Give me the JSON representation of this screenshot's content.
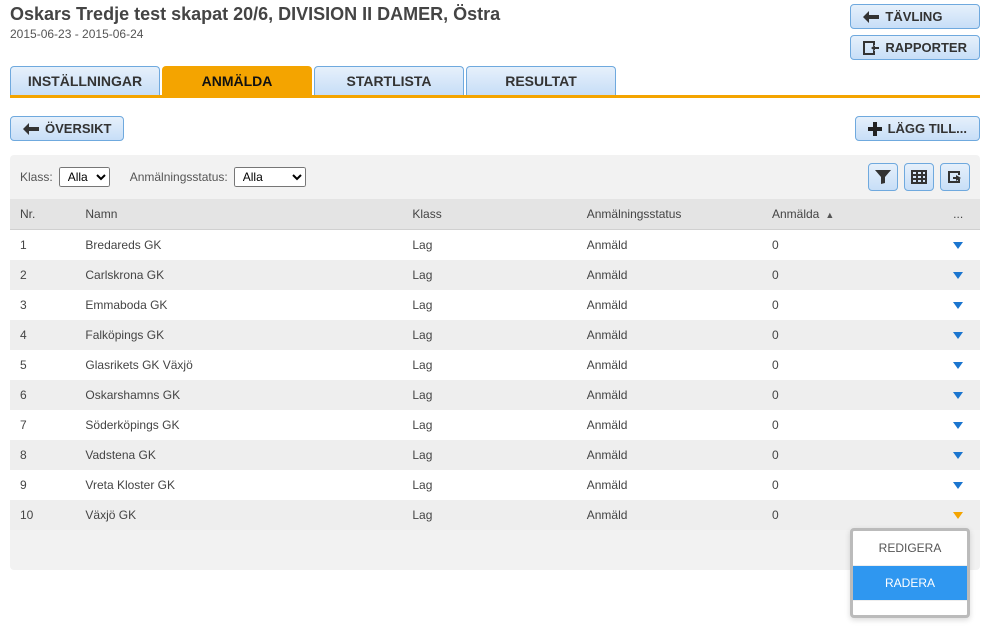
{
  "header": {
    "title": "Oskars Tredje test skapat 20/6, DIVISION II DAMER, Östra",
    "dates": "2015-06-23 - 2015-06-24"
  },
  "top_buttons": {
    "tavling": "TÄVLING",
    "rapporter": "RAPPORTER"
  },
  "tabs": [
    {
      "label": "INSTÄLLNINGAR",
      "active": false
    },
    {
      "label": "ANMÄLDA",
      "active": true
    },
    {
      "label": "STARTLISTA",
      "active": false
    },
    {
      "label": "RESULTAT",
      "active": false
    }
  ],
  "secbar": {
    "oversikt": "ÖVERSIKT",
    "laggtill": "LÄGG TILL..."
  },
  "filters": {
    "klass_label": "Klass:",
    "klass_value": "Alla",
    "status_label": "Anmälningsstatus:",
    "status_value": "Alla"
  },
  "columns": {
    "nr": "Nr.",
    "namn": "Namn",
    "klass": "Klass",
    "status": "Anmälningsstatus",
    "anmalda": "Anmälda",
    "actions": "..."
  },
  "rows": [
    {
      "nr": "1",
      "namn": "Bredareds GK",
      "klass": "Lag",
      "status": "Anmäld",
      "anmalda": "0",
      "open": false
    },
    {
      "nr": "2",
      "namn": "Carlskrona GK",
      "klass": "Lag",
      "status": "Anmäld",
      "anmalda": "0",
      "open": false
    },
    {
      "nr": "3",
      "namn": "Emmaboda GK",
      "klass": "Lag",
      "status": "Anmäld",
      "anmalda": "0",
      "open": false
    },
    {
      "nr": "4",
      "namn": "Falköpings GK",
      "klass": "Lag",
      "status": "Anmäld",
      "anmalda": "0",
      "open": false
    },
    {
      "nr": "5",
      "namn": "Glasrikets GK Växjö",
      "klass": "Lag",
      "status": "Anmäld",
      "anmalda": "0",
      "open": false
    },
    {
      "nr": "6",
      "namn": "Oskarshamns GK",
      "klass": "Lag",
      "status": "Anmäld",
      "anmalda": "0",
      "open": false
    },
    {
      "nr": "7",
      "namn": "Söderköpings GK",
      "klass": "Lag",
      "status": "Anmäld",
      "anmalda": "0",
      "open": false
    },
    {
      "nr": "8",
      "namn": "Vadstena GK",
      "klass": "Lag",
      "status": "Anmäld",
      "anmalda": "0",
      "open": false
    },
    {
      "nr": "9",
      "namn": "Vreta Kloster GK",
      "klass": "Lag",
      "status": "Anmäld",
      "anmalda": "0",
      "open": false
    },
    {
      "nr": "10",
      "namn": "Växjö GK",
      "klass": "Lag",
      "status": "Anmäld",
      "anmalda": "0",
      "open": true
    }
  ],
  "context_menu": {
    "edit": "REDIGERA",
    "delete": "RADERA"
  }
}
